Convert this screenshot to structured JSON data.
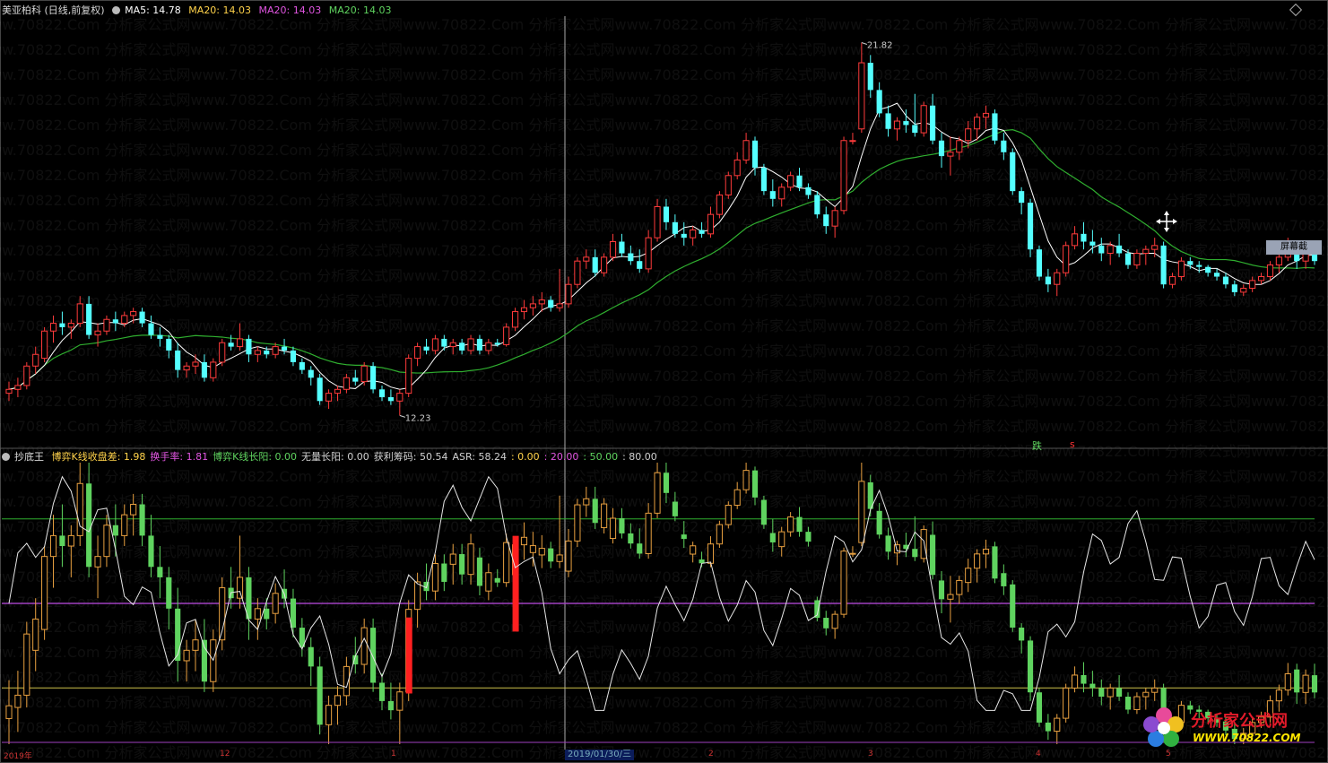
{
  "main_header": {
    "title": "美亚柏科 (日线,前复权)",
    "ma5": "MA5: 14.78",
    "ma20a": "MA20: 14.03",
    "ma20b": "MA20: 14.03",
    "ma20c": "MA20: 14.03"
  },
  "sub_header": {
    "name": "抄底王",
    "items": [
      {
        "text": "博弈K线收盘差: 1.98",
        "color": "#ffd24a"
      },
      {
        "text": "换手率: 1.81",
        "color": "#e055e0"
      },
      {
        "text": "博弈K线长阳: 0.00",
        "color": "#5fd35f"
      },
      {
        "text": "无量长阳: 0.00",
        "color": "#d0d0d0"
      },
      {
        "text": "获利筹码: 50.54",
        "color": "#d0d0d0"
      },
      {
        "text": "ASR: 58.24",
        "color": "#d0d0d0"
      },
      {
        "text": ": 0.00",
        "color": "#ffd24a"
      },
      {
        "text": ": 20.00",
        "color": "#e055e0"
      },
      {
        "text": ": 50.00",
        "color": "#5fd35f"
      },
      {
        "text": ": 80.00",
        "color": "#d0d0d0"
      }
    ]
  },
  "watermark": "分析家公式网www.70822.Com",
  "logo": {
    "title": "分析家公式网",
    "url": "WWW.70822.COM"
  },
  "screenshot_button": "屏幕截",
  "fall_badge": "跌",
  "fall_mark": "s",
  "date_badge": "2019/01/30/三",
  "x_ticks": [
    "2019年",
    "12",
    "1",
    "2",
    "3",
    "4",
    "5"
  ],
  "colors": {
    "up": "#ff3b3b",
    "down": "#54ffff",
    "ma5": "#ffffff",
    "ma20": "#2fae2f",
    "sub_up": "#e8a040",
    "sub_down": "#5fd35f"
  },
  "chart_data": [
    {
      "type": "candlestick",
      "title": "美亚柏科 (日线,前复权)",
      "ylim": [
        11.5,
        22.5
      ],
      "annotations": [
        {
          "text": "21.82",
          "value": 21.82
        },
        {
          "text": "12.23",
          "value": 12.23
        }
      ],
      "ohlc": [
        [
          12.8,
          13.1,
          12.6,
          12.9
        ],
        [
          12.9,
          13.2,
          12.7,
          13.0
        ],
        [
          13.0,
          13.6,
          12.9,
          13.5
        ],
        [
          13.5,
          14.0,
          13.3,
          13.8
        ],
        [
          13.7,
          14.5,
          13.6,
          14.4
        ],
        [
          14.4,
          14.8,
          14.1,
          14.6
        ],
        [
          14.6,
          14.9,
          14.3,
          14.5
        ],
        [
          14.5,
          14.7,
          14.2,
          14.6
        ],
        [
          14.6,
          15.3,
          14.5,
          15.1
        ],
        [
          15.1,
          15.3,
          14.2,
          14.3
        ],
        [
          14.3,
          14.6,
          14.0,
          14.4
        ],
        [
          14.4,
          14.8,
          14.3,
          14.7
        ],
        [
          14.7,
          14.9,
          14.4,
          14.6
        ],
        [
          14.6,
          14.9,
          14.5,
          14.8
        ],
        [
          14.8,
          15.0,
          14.6,
          14.9
        ],
        [
          14.9,
          15.0,
          14.5,
          14.6
        ],
        [
          14.6,
          14.8,
          14.2,
          14.3
        ],
        [
          14.3,
          14.5,
          14.0,
          14.2
        ],
        [
          14.2,
          14.3,
          13.7,
          13.9
        ],
        [
          13.9,
          14.1,
          13.2,
          13.4
        ],
        [
          13.4,
          13.6,
          13.2,
          13.5
        ],
        [
          13.5,
          13.8,
          13.3,
          13.6
        ],
        [
          13.6,
          13.8,
          13.1,
          13.2
        ],
        [
          13.2,
          13.7,
          13.1,
          13.6
        ],
        [
          13.6,
          14.2,
          13.5,
          14.1
        ],
        [
          14.1,
          14.3,
          13.9,
          14.0
        ],
        [
          14.0,
          14.6,
          13.9,
          14.2
        ],
        [
          14.2,
          14.3,
          13.6,
          13.8
        ],
        [
          13.8,
          14.0,
          13.6,
          13.9
        ],
        [
          13.9,
          14.0,
          13.7,
          13.8
        ],
        [
          13.8,
          14.1,
          13.7,
          14.0
        ],
        [
          14.0,
          14.2,
          13.8,
          13.9
        ],
        [
          13.9,
          14.0,
          13.5,
          13.6
        ],
        [
          13.6,
          13.7,
          13.3,
          13.4
        ],
        [
          13.4,
          13.5,
          13.0,
          13.2
        ],
        [
          13.2,
          13.3,
          12.5,
          12.6
        ],
        [
          12.6,
          12.9,
          12.4,
          12.8
        ],
        [
          12.8,
          13.0,
          12.6,
          12.9
        ],
        [
          12.9,
          13.3,
          12.8,
          13.2
        ],
        [
          13.2,
          13.4,
          13.0,
          13.1
        ],
        [
          13.1,
          13.6,
          13.0,
          13.5
        ],
        [
          13.5,
          13.6,
          12.8,
          12.9
        ],
        [
          12.9,
          13.0,
          12.6,
          12.7
        ],
        [
          12.7,
          12.9,
          12.5,
          12.6
        ],
        [
          12.6,
          12.9,
          12.23,
          12.8
        ],
        [
          12.8,
          13.8,
          12.7,
          13.7
        ],
        [
          13.7,
          14.1,
          13.5,
          14.0
        ],
        [
          14.0,
          14.2,
          13.8,
          13.9
        ],
        [
          13.9,
          14.3,
          13.8,
          14.2
        ],
        [
          14.2,
          14.3,
          13.9,
          14.0
        ],
        [
          14.0,
          14.2,
          13.8,
          14.1
        ],
        [
          14.1,
          14.2,
          13.8,
          13.9
        ],
        [
          13.9,
          14.3,
          13.8,
          14.2
        ],
        [
          14.2,
          14.3,
          13.8,
          13.9
        ],
        [
          13.9,
          14.2,
          13.8,
          14.1
        ],
        [
          14.1,
          14.2,
          14.0,
          14.05
        ],
        [
          14.05,
          14.6,
          14.0,
          14.5
        ],
        [
          14.5,
          15.0,
          14.4,
          14.9
        ],
        [
          14.9,
          15.2,
          14.7,
          15.0
        ],
        [
          15.0,
          15.3,
          14.8,
          15.1
        ],
        [
          15.1,
          15.4,
          14.9,
          15.2
        ],
        [
          15.2,
          15.3,
          14.9,
          15.0
        ],
        [
          15.0,
          16.0,
          14.9,
          15.1
        ],
        [
          15.1,
          15.8,
          15.0,
          15.6
        ],
        [
          15.6,
          16.3,
          15.5,
          16.2
        ],
        [
          16.2,
          16.5,
          16.0,
          16.3
        ],
        [
          16.3,
          16.5,
          15.8,
          15.9
        ],
        [
          15.9,
          16.4,
          15.8,
          16.3
        ],
        [
          16.3,
          16.9,
          16.2,
          16.7
        ],
        [
          16.7,
          16.9,
          16.3,
          16.4
        ],
        [
          16.4,
          16.6,
          16.1,
          16.2
        ],
        [
          16.2,
          16.5,
          15.9,
          16.0
        ],
        [
          16.0,
          17.0,
          15.9,
          16.8
        ],
        [
          16.8,
          17.8,
          16.7,
          17.6
        ],
        [
          17.6,
          17.8,
          17.0,
          17.2
        ],
        [
          17.2,
          17.4,
          16.8,
          16.9
        ],
        [
          16.9,
          17.2,
          16.6,
          16.8
        ],
        [
          16.8,
          17.1,
          16.6,
          17.0
        ],
        [
          17.0,
          17.2,
          16.8,
          16.9
        ],
        [
          16.9,
          17.6,
          16.8,
          17.4
        ],
        [
          17.4,
          18.0,
          17.3,
          17.9
        ],
        [
          17.9,
          18.5,
          17.8,
          18.4
        ],
        [
          18.4,
          19.0,
          18.3,
          18.8
        ],
        [
          18.8,
          19.5,
          18.7,
          19.3
        ],
        [
          19.3,
          19.4,
          18.4,
          18.6
        ],
        [
          18.6,
          18.7,
          17.9,
          18.0
        ],
        [
          18.0,
          18.3,
          17.6,
          17.8
        ],
        [
          17.8,
          18.2,
          17.6,
          18.1
        ],
        [
          18.1,
          18.5,
          18.0,
          18.4
        ],
        [
          18.4,
          18.6,
          18.0,
          18.1
        ],
        [
          18.1,
          18.2,
          17.8,
          17.9
        ],
        [
          17.9,
          18.0,
          17.3,
          17.4
        ],
        [
          17.4,
          17.6,
          16.9,
          17.1
        ],
        [
          17.1,
          17.6,
          16.8,
          17.5
        ],
        [
          17.5,
          19.4,
          17.4,
          19.3
        ],
        [
          19.3,
          19.5,
          19.2,
          19.3
        ],
        [
          19.6,
          21.82,
          19.5,
          21.3
        ],
        [
          21.3,
          21.5,
          20.4,
          20.6
        ],
        [
          20.6,
          20.8,
          19.9,
          20.0
        ],
        [
          20.0,
          20.2,
          19.4,
          19.6
        ],
        [
          19.6,
          19.9,
          19.3,
          19.8
        ],
        [
          19.8,
          20.1,
          19.5,
          19.7
        ],
        [
          19.7,
          20.5,
          19.4,
          19.5
        ],
        [
          19.5,
          20.3,
          19.4,
          20.2
        ],
        [
          20.2,
          20.5,
          19.2,
          19.3
        ],
        [
          19.3,
          19.5,
          18.6,
          18.9
        ],
        [
          18.9,
          19.4,
          18.4,
          19.0
        ],
        [
          19.0,
          19.4,
          18.8,
          19.3
        ],
        [
          19.3,
          19.8,
          19.1,
          19.6
        ],
        [
          19.6,
          20.0,
          19.3,
          19.9
        ],
        [
          19.9,
          20.2,
          19.6,
          20.0
        ],
        [
          20.0,
          20.1,
          19.2,
          19.3
        ],
        [
          19.3,
          19.5,
          18.8,
          19.0
        ],
        [
          19.0,
          19.1,
          17.9,
          18.0
        ],
        [
          18.0,
          18.1,
          17.4,
          17.7
        ],
        [
          17.7,
          17.8,
          16.3,
          16.5
        ],
        [
          16.5,
          16.6,
          15.7,
          15.8
        ],
        [
          15.8,
          16.0,
          15.4,
          15.6
        ],
        [
          15.6,
          16.0,
          15.3,
          15.9
        ],
        [
          15.9,
          16.7,
          15.8,
          16.6
        ],
        [
          16.6,
          17.1,
          16.5,
          16.9
        ],
        [
          16.9,
          17.2,
          16.5,
          16.7
        ],
        [
          16.7,
          17.0,
          16.4,
          16.6
        ],
        [
          16.6,
          16.8,
          16.2,
          16.4
        ],
        [
          16.4,
          16.7,
          16.1,
          16.6
        ],
        [
          16.6,
          16.9,
          16.3,
          16.4
        ],
        [
          16.4,
          16.5,
          16.0,
          16.1
        ],
        [
          16.1,
          16.5,
          16.0,
          16.4
        ],
        [
          16.4,
          16.6,
          16.1,
          16.5
        ],
        [
          16.5,
          16.8,
          16.3,
          16.6
        ],
        [
          16.6,
          16.7,
          15.5,
          15.6
        ],
        [
          15.6,
          15.9,
          15.5,
          15.8
        ],
        [
          15.8,
          16.3,
          15.7,
          16.2
        ],
        [
          16.2,
          16.3,
          16.0,
          16.1
        ],
        [
          16.1,
          16.2,
          15.9,
          16.05
        ],
        [
          16.05,
          16.1,
          15.8,
          15.9
        ],
        [
          15.9,
          16.0,
          15.7,
          15.8
        ],
        [
          15.8,
          15.9,
          15.5,
          15.6
        ],
        [
          15.6,
          15.7,
          15.3,
          15.4
        ],
        [
          15.4,
          15.6,
          15.3,
          15.5
        ],
        [
          15.5,
          15.8,
          15.4,
          15.7
        ],
        [
          15.7,
          15.9,
          15.6,
          15.8
        ],
        [
          15.8,
          16.2,
          15.7,
          16.1
        ],
        [
          16.1,
          16.4,
          15.9,
          16.3
        ],
        [
          16.3,
          16.8,
          16.2,
          16.6
        ],
        [
          16.6,
          16.7,
          16.0,
          16.2
        ],
        [
          16.2,
          16.6,
          16.0,
          16.5
        ],
        [
          16.5,
          16.7,
          16.1,
          16.2
        ]
      ]
    },
    {
      "type": "line",
      "title": "抄底王",
      "ylim": [
        0,
        100
      ],
      "ref_lines": [
        0,
        20,
        50,
        80
      ]
    }
  ]
}
